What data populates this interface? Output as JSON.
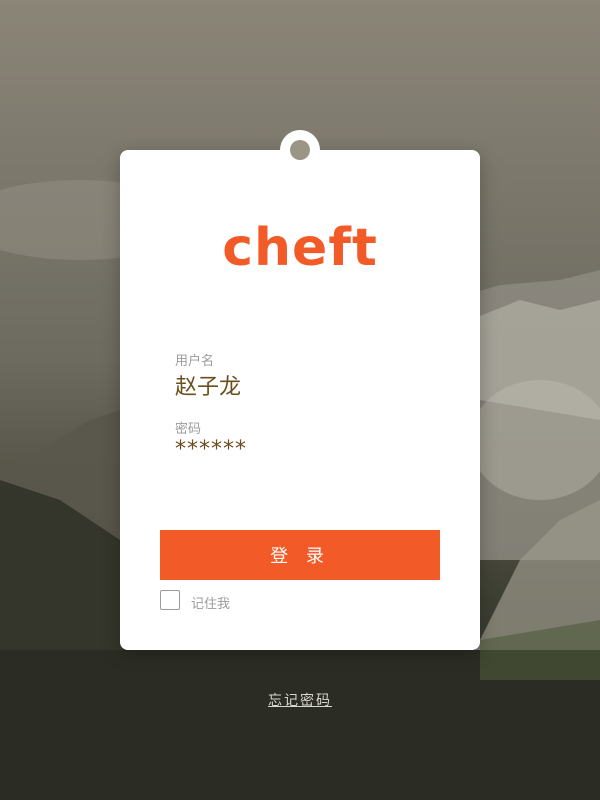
{
  "logo": {
    "text": "cheft",
    "color": "#f25a27"
  },
  "form": {
    "username_label": "用户名",
    "username_value": "赵子龙",
    "password_label": "密码",
    "password_value": "******",
    "login_label": "登 录",
    "remember_label": "记住我",
    "remember_checked": false
  },
  "footer": {
    "forgot_label": "忘记密码"
  },
  "colors": {
    "accent": "#f25a27",
    "value_text": "#6b4e1e",
    "label_text": "#9b9b9b"
  }
}
